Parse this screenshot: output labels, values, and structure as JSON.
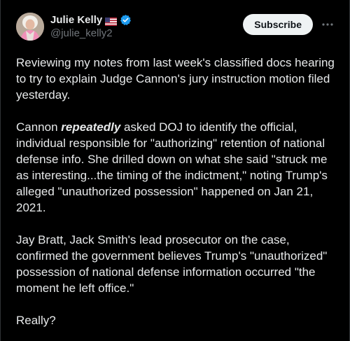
{
  "author": {
    "display_name": "Julie Kelly",
    "handle": "@julie_kelly2",
    "flag_icon": "us-flag-icon",
    "verified_icon": "verified-badge-icon",
    "verified_color": "#1d9bf0"
  },
  "actions": {
    "subscribe_label": "Subscribe",
    "more_icon": "more-dots-icon"
  },
  "tweet": {
    "p1": "Reviewing my notes from last week's classified docs hearing to try to explain Judge Cannon's jury instruction motion filed yesterday.",
    "p2_before": "Cannon ",
    "p2_emphasis": "repeatedly",
    "p2_after": " asked DOJ to identify the official, individual responsible for \"authorizing\" retention of national defense info. She drilled down on what she said \"struck me as interesting...the timing of the indictment,\" noting Trump's alleged \"unauthorized possession\" happened on Jan 21, 2021.",
    "p3": "Jay Bratt, Jack Smith's lead prosecutor on the case, confirmed the government believes Trump's \"unauthorized\" possession of national defense information occurred \"the moment he left office.\"",
    "p4": "Really?"
  },
  "colors": {
    "background": "#000000",
    "text": "#e7e9ea",
    "secondary_text": "#71767b",
    "button_bg": "#eff3f4",
    "button_text": "#0f1419",
    "border": "#2f3336"
  }
}
